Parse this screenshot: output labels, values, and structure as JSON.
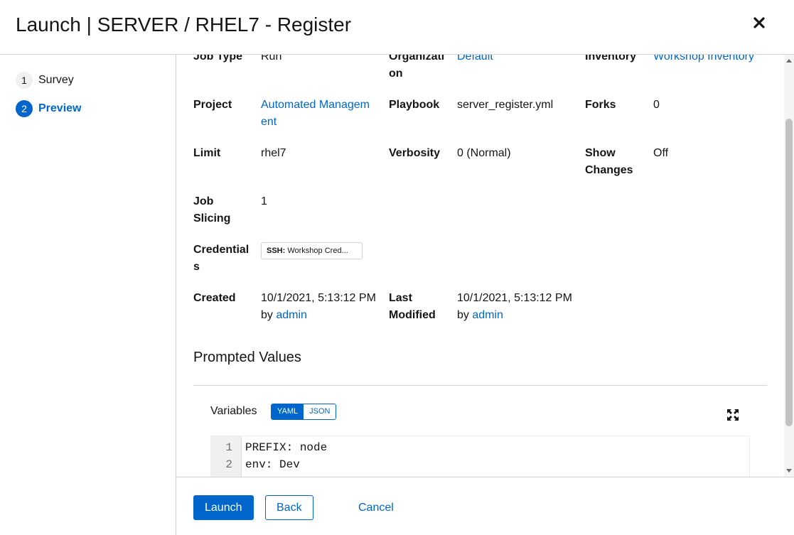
{
  "modal": {
    "title": "Launch | SERVER / RHEL7 - Register"
  },
  "wizard": {
    "steps": [
      {
        "number": "1",
        "label": "Survey"
      },
      {
        "number": "2",
        "label": "Preview"
      }
    ]
  },
  "details": {
    "job_type": {
      "label": "Job Type",
      "value": "Run"
    },
    "organization": {
      "label": "Organization",
      "value": "Default"
    },
    "inventory": {
      "label": "Inventory",
      "value": "Workshop Inventory"
    },
    "project": {
      "label": "Project",
      "value": "Automated Management"
    },
    "playbook": {
      "label": "Playbook",
      "value": "server_register.yml"
    },
    "forks": {
      "label": "Forks",
      "value": "0"
    },
    "limit": {
      "label": "Limit",
      "value": "rhel7"
    },
    "verbosity": {
      "label": "Verbosity",
      "value": "0 (Normal)"
    },
    "show_changes": {
      "label": "Show Changes",
      "value": "Off"
    },
    "job_slicing": {
      "label": "Job Slicing",
      "value": "1"
    },
    "credentials": {
      "label": "Credentials",
      "chip_type": "SSH:",
      "chip_name": "Workshop Cred..."
    },
    "created": {
      "label": "Created",
      "date": "10/1/2021, 5:13:12 PM",
      "by": "by",
      "user": "admin"
    },
    "modified": {
      "label": "Last Modified",
      "date": "10/1/2021, 5:13:12 PM",
      "by": "by",
      "user": "admin"
    }
  },
  "prompted": {
    "title": "Prompted Values",
    "variables_label": "Variables",
    "toggle_yaml": "YAML",
    "toggle_json": "JSON",
    "code": {
      "line_numbers": [
        "1",
        "2"
      ],
      "lines": [
        "PREFIX: node",
        "env: Dev"
      ]
    }
  },
  "footer": {
    "launch": "Launch",
    "back": "Back",
    "cancel": "Cancel"
  },
  "colors": {
    "accent": "#0066cc",
    "border": "#d2d2d2"
  }
}
